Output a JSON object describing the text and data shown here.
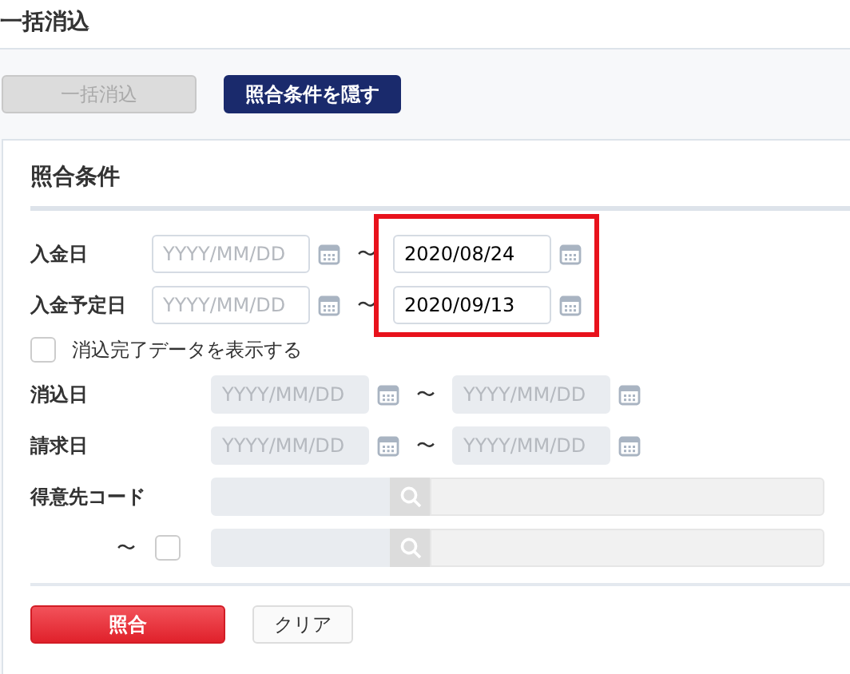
{
  "page": {
    "title": "一括消込"
  },
  "toolbar": {
    "buttons": [
      {
        "label": "一括消込",
        "kind": "secondary",
        "disabled": true
      },
      {
        "label": "照合条件を隠す",
        "kind": "primary",
        "disabled": false
      }
    ]
  },
  "criteria": {
    "title": "照合条件",
    "payment_dates": [
      {
        "label": "入金日",
        "from": {
          "placeholder": "YYYY/MM/DD"
        },
        "separator": "〜",
        "to": {
          "value": "2020/08/24"
        },
        "highlighted": true
      },
      {
        "label": "入金予定日",
        "from": {
          "placeholder": "YYYY/MM/DD"
        },
        "separator": "〜",
        "to": {
          "value": "2020/09/13"
        },
        "highlighted": true
      }
    ],
    "show_completed": {
      "label": "消込完了データを表示する",
      "checked": false
    },
    "cleared_dates": [
      {
        "label": "消込日",
        "disabled": true,
        "from": {
          "placeholder": "YYYY/MM/DD"
        },
        "separator": "〜",
        "to": {
          "placeholder": "YYYY/MM/DD"
        }
      },
      {
        "label": "請求日",
        "disabled": true,
        "from": {
          "placeholder": "YYYY/MM/DD"
        },
        "separator": "〜",
        "to": {
          "placeholder": "YYYY/MM/DD"
        }
      }
    ],
    "customer_code": [
      {
        "label": "得意先コード",
        "disabled": true
      },
      {
        "separator": "〜",
        "checked": false,
        "disabled": true
      }
    ],
    "actions": [
      {
        "label": "照合",
        "kind": "primary"
      },
      {
        "label": "クリア",
        "kind": "secondary"
      }
    ]
  }
}
